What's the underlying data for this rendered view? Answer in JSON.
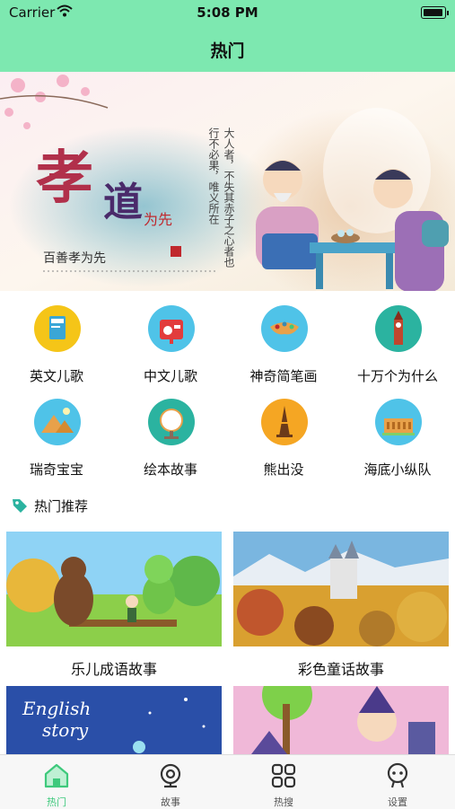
{
  "status": {
    "carrier": "Carrier",
    "time": "5:08 PM"
  },
  "navbar": {
    "title": "热门"
  },
  "banner": {
    "title_chars": [
      "孝",
      "道"
    ],
    "sub_red": "为先",
    "caption": "百善孝为先",
    "vertical_1": "大人者，不失其赤子之心者也",
    "vertical_2": "行不必果，唯义所在"
  },
  "categories": [
    {
      "label": "英文儿歌",
      "icon": "book-icon",
      "bg": "#f5c518"
    },
    {
      "label": "中文儿歌",
      "icon": "radio-icon",
      "bg": "#4fc3e8"
    },
    {
      "label": "神奇简笔画",
      "icon": "paint-icon",
      "bg": "#4fc3e8"
    },
    {
      "label": "十万个为什么",
      "icon": "bigben-icon",
      "bg": "#2bb3a0"
    },
    {
      "label": "瑞奇宝宝",
      "icon": "pyramid-icon",
      "bg": "#4fc3e8"
    },
    {
      "label": "绘本故事",
      "icon": "mirror-icon",
      "bg": "#2bb3a0"
    },
    {
      "label": "熊出没",
      "icon": "eiffel-icon",
      "bg": "#f5a623"
    },
    {
      "label": "海底小纵队",
      "icon": "colosseum-icon",
      "bg": "#4fc3e8"
    }
  ],
  "section": {
    "title": "热门推荐"
  },
  "cards": [
    {
      "caption": "乐儿成语故事"
    },
    {
      "caption": "彩色童话故事"
    },
    {
      "caption": "",
      "text_1": "English",
      "text_2": "story"
    },
    {
      "caption": ""
    }
  ],
  "tabs": [
    {
      "label": "热门",
      "icon": "home-icon",
      "active": true
    },
    {
      "label": "故事",
      "icon": "webcam-icon",
      "active": false
    },
    {
      "label": "热搜",
      "icon": "grid-icon",
      "active": false
    },
    {
      "label": "设置",
      "icon": "robot-icon",
      "active": false
    }
  ],
  "colors": {
    "accent": "#7de8b0",
    "active_tab": "#3ec97c"
  }
}
